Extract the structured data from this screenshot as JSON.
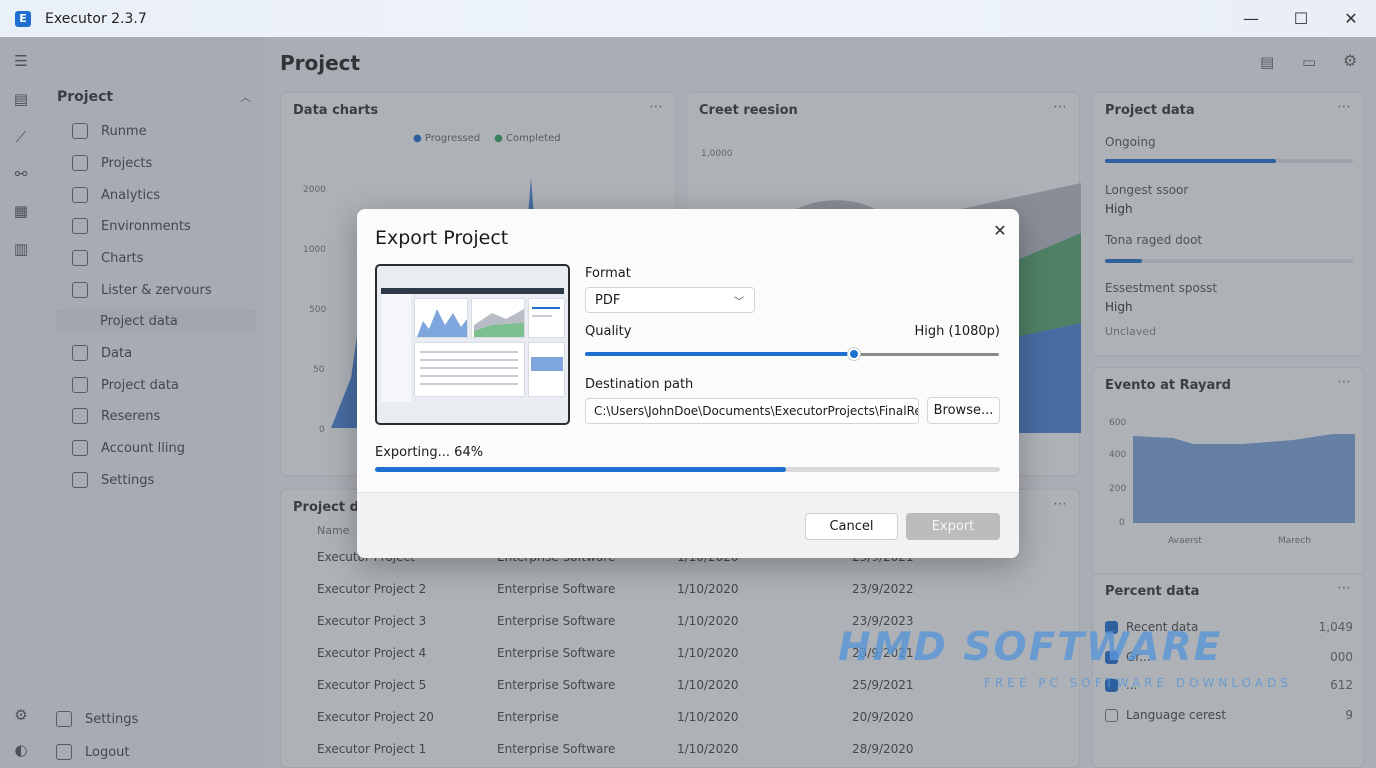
{
  "window": {
    "title": "Executor 2.3.7",
    "logo_letter": "E",
    "minimize_glyph": "—",
    "maximize_glyph": "☐",
    "close_glyph": "✕"
  },
  "rail": {
    "icons": [
      "menu-icon",
      "document-icon",
      "chart-icon",
      "flow-icon",
      "table-icon",
      "database-icon",
      "settings-icon",
      "logout-icon"
    ]
  },
  "sidebar": {
    "section": "Project",
    "items": [
      {
        "label": "Runme"
      },
      {
        "label": "Projects"
      },
      {
        "label": "Analytics"
      },
      {
        "label": "Environments"
      },
      {
        "label": "Charts"
      },
      {
        "label": "Lister & zervours"
      },
      {
        "label": "Project data"
      },
      {
        "label": "Data"
      },
      {
        "label": "Project data"
      },
      {
        "label": "Reserens"
      },
      {
        "label": "Account lling"
      },
      {
        "label": "Settings"
      }
    ],
    "bottom": [
      {
        "label": "Settings"
      },
      {
        "label": "Logout"
      }
    ]
  },
  "main": {
    "page_title": "Project",
    "cards": {
      "data_charts": {
        "title": "Data charts",
        "legend": [
          "Progressed",
          "Completed"
        ],
        "y_ticks": [
          "2000",
          "1000",
          "500",
          "50",
          "0"
        ]
      },
      "chart_revision": {
        "title": "Creet reesion",
        "y_tick": "1,0000"
      },
      "project_data": {
        "title": "Project data",
        "rows": [
          {
            "label": "Ongoing",
            "value": "",
            "progress": 0.69
          },
          {
            "label": "Longest ssoor",
            "value": "High",
            "progress": null
          },
          {
            "label": "Tona raged doot",
            "value": "",
            "progress": 0.15
          },
          {
            "label": "Essestment sposst",
            "value": "High",
            "progress": null
          },
          {
            "label": "Unclaved",
            "value": "",
            "progress": null
          }
        ]
      },
      "events": {
        "title": "Evento at Rayard",
        "y_ticks": [
          "600",
          "400",
          "200",
          "0"
        ],
        "x_ticks": [
          "Avaerst",
          "Marech"
        ]
      },
      "table": {
        "title": "Project data",
        "header": [
          "Name",
          "",
          "",
          ""
        ],
        "rows": [
          [
            "Executor Project",
            "Enterprise Software",
            "1/10/2020",
            "23/9/2021"
          ],
          [
            "Executor Project 2",
            "Enterprise Software",
            "1/10/2020",
            "23/9/2022"
          ],
          [
            "Executor Project 3",
            "Enterprise Software",
            "1/10/2020",
            "23/9/2023"
          ],
          [
            "Executor Project 4",
            "Enterprise Software",
            "1/10/2020",
            "23/9/2021"
          ],
          [
            "Executor Project 5",
            "Enterprise Software",
            "1/10/2020",
            "25/9/2021"
          ],
          [
            "Executor Project 20",
            "Enterprise",
            "1/10/2020",
            "20/9/2020"
          ],
          [
            "Executor Project 1",
            "Enterprise Software",
            "1/10/2020",
            "28/9/2020"
          ]
        ]
      },
      "percent": {
        "title": "Percent data",
        "rows": [
          {
            "label": "Recent data",
            "value": "1,049",
            "checked": true
          },
          {
            "label": "Gr...",
            "value": "000",
            "checked": true
          },
          {
            "label": "...",
            "value": "612",
            "checked": true
          },
          {
            "label": "Language cerest",
            "value": "9",
            "checked": false
          }
        ]
      }
    }
  },
  "dialog": {
    "title": "Export Project",
    "format_label": "Format",
    "format_value": "PDF",
    "quality_label": "Quality",
    "quality_value": "High (1080p)",
    "quality_level": 0.65,
    "destination_label": "Destination path",
    "destination_value": "C:\\Users\\JohnDoe\\Documents\\ExecutorProjects\\FinalRender",
    "browse_label": "Browse...",
    "progress_text": "Exporting... 64%",
    "progress": 0.657,
    "cancel_label": "Cancel",
    "export_label": "Export"
  },
  "watermark": {
    "main": "HMD SOFTWARE",
    "sub": "FREE PC SOFTWARE DOWNLOADS"
  }
}
